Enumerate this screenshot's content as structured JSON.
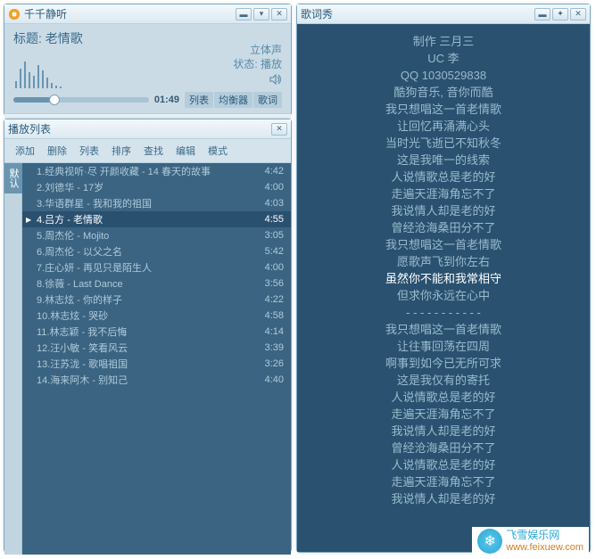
{
  "player": {
    "app_title": "千千静听",
    "song_title": "标题: 老情歌",
    "stereo": "立体声",
    "status": "状态: 播放",
    "time": "01:49",
    "right_tabs": [
      "列表",
      "均衡器",
      "歌词"
    ]
  },
  "playlist": {
    "title": "播放列表",
    "menus": [
      "添加",
      "删除",
      "列表",
      "排序",
      "查找",
      "编辑",
      "模式"
    ],
    "side_tab": "默认",
    "current_index": 3,
    "tracks": [
      {
        "n": "1",
        "name": "经典视听·尽 开颜收藏 - 14 春天的故事",
        "dur": "4:42"
      },
      {
        "n": "2",
        "name": "刘德华 - 17岁",
        "dur": "4:00"
      },
      {
        "n": "3",
        "name": "华语群星 - 我和我的祖国",
        "dur": "4:03"
      },
      {
        "n": "4",
        "name": "吕方 - 老情歌",
        "dur": "4:55"
      },
      {
        "n": "5",
        "name": "周杰伦 - Mojito",
        "dur": "3:05"
      },
      {
        "n": "6",
        "name": "周杰伦 - 以父之名",
        "dur": "5:42"
      },
      {
        "n": "7",
        "name": "庄心妍 - 再见只是陌生人",
        "dur": "4:00"
      },
      {
        "n": "8",
        "name": "徐薇 - Last Dance",
        "dur": "3:56"
      },
      {
        "n": "9",
        "name": "林志炫 - 你的样子",
        "dur": "4:22"
      },
      {
        "n": "10",
        "name": "林志炫 - 哭砂",
        "dur": "4:58"
      },
      {
        "n": "11",
        "name": "林志颖 - 我不后悔",
        "dur": "4:14"
      },
      {
        "n": "12",
        "name": "汪小敏 - 笑看风云",
        "dur": "3:39"
      },
      {
        "n": "13",
        "name": "汪苏泷 - 歌唱祖国",
        "dur": "3:26"
      },
      {
        "n": "14",
        "name": "海来阿木 - 别知己",
        "dur": "4:40"
      }
    ]
  },
  "lyrics": {
    "title": "歌词秀",
    "active_index": 14,
    "lines": [
      "制作 三月三",
      "UC 李",
      "QQ 1030529838",
      "酷狗音乐, 音你而酷",
      "我只想唱这一首老情歌",
      "让回忆再涌满心头",
      "当时光飞逝已不知秋冬",
      "这是我唯一的线索",
      "人说情歌总是老的好",
      "走遍天涯海角忘不了",
      "我说情人却是老的好",
      "曾经沧海桑田分不了",
      "我只想唱这一首老情歌",
      "愿歌声飞到你左右",
      "虽然你不能和我常相守",
      "但求你永远在心中",
      "- - - - - - - - - - -",
      "我只想唱这一首老情歌",
      "让往事回荡在四周",
      "啊事到如今已无所可求",
      "这是我仅有的寄托",
      "人说情歌总是老的好",
      "走遍天涯海角忘不了",
      "我说情人却是老的好",
      "曾经沧海桑田分不了",
      "人说情歌总是老的好",
      "走遍天涯海角忘不了",
      "我说情人却是老的好"
    ]
  },
  "watermark": {
    "name": "飞雪娱乐网",
    "url": "www.feixuew.com"
  }
}
